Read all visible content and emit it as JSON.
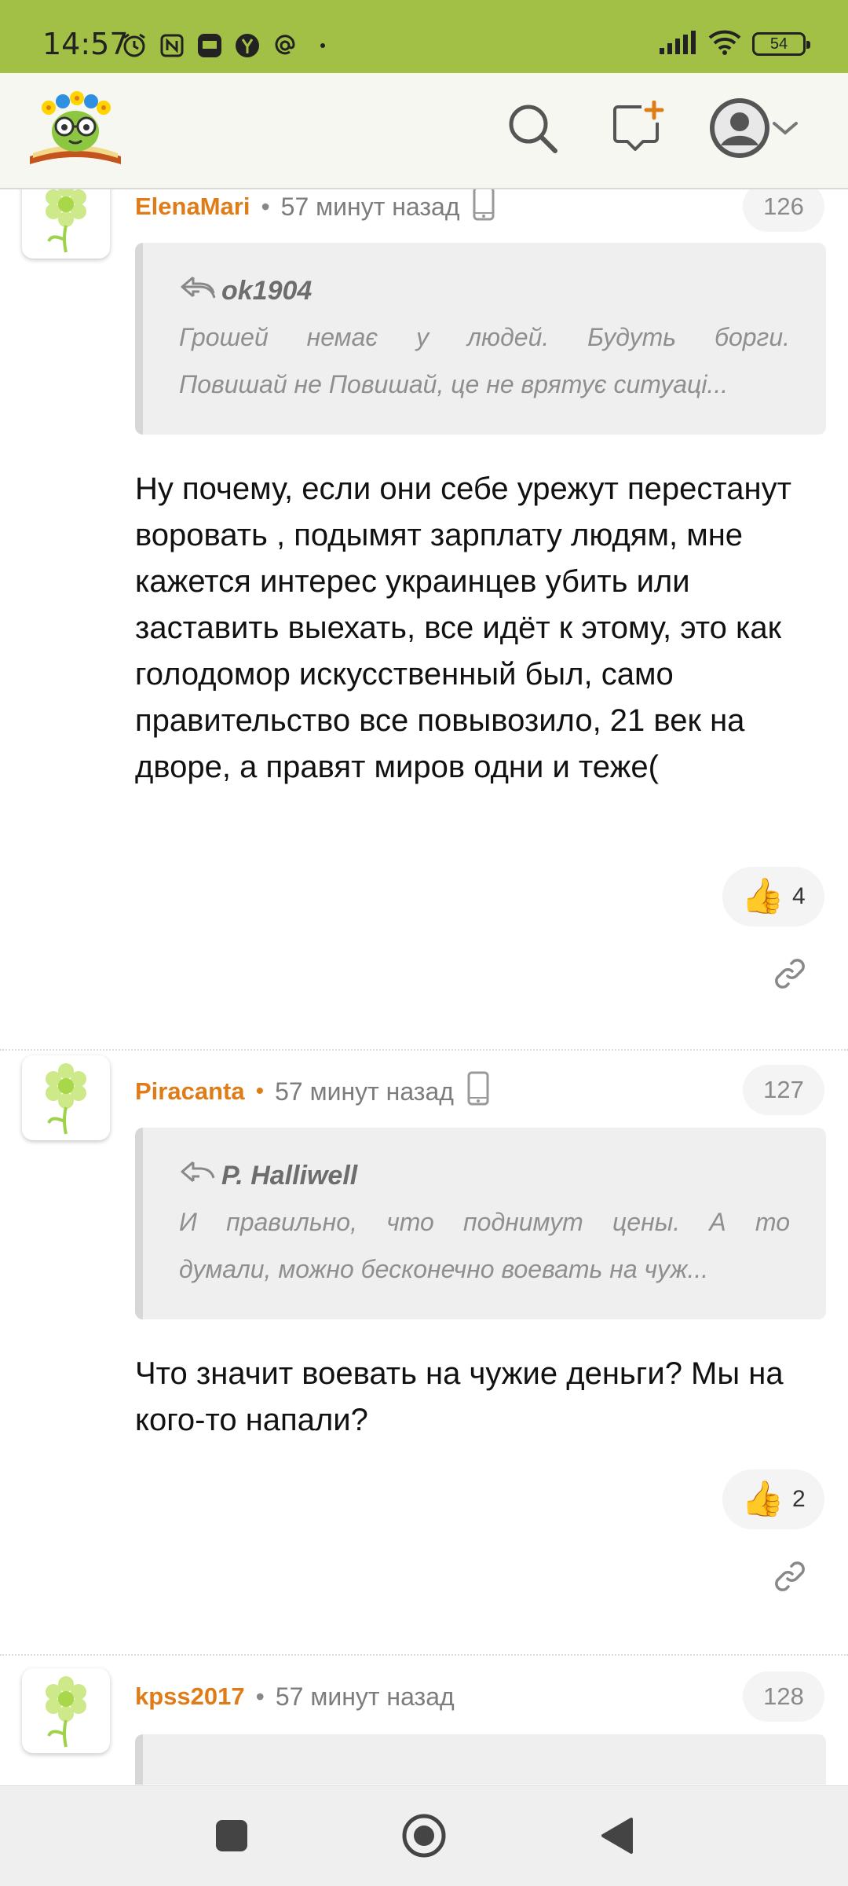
{
  "status_bar": {
    "time": "14:57",
    "left_icons": [
      "alarm-icon",
      "nfc-icon",
      "ad-blocker-icon",
      "yandex-icon",
      "at-icon",
      "dot-icon"
    ],
    "battery": "54"
  },
  "header": {
    "logo": "reader-bookworm-logo",
    "icons": [
      "search-icon",
      "new-message-icon",
      "user-avatar-icon",
      "chevron-down-icon"
    ]
  },
  "comments": [
    {
      "author": "ElenaMari",
      "time": "57 минут назад",
      "device_icon": "mobile-phone-icon",
      "number": "126",
      "quote": {
        "author": "ok1904",
        "line1": "Грошей немає у людей. Будуть борги.",
        "line2": "Повишай не Повишай, це не врятує ситуаці..."
      },
      "text": "Ну почему, если они себе урежут перестанут воровать , подымят зарплату людям, мне кажется интерес украинцев убить или заставить выехать, все идёт к этому, это как голодомор искусственный был, само правительство все повывозило, 21 век на дворе, а правят миров одни и теже(",
      "likes": "4"
    },
    {
      "author": "Piracanta",
      "time": "57 минут назад",
      "device_icon": "mobile-phone-icon",
      "number": "127",
      "quote": {
        "author": "P. Halliwell",
        "line1": "И правильно, что поднимут цены. А то",
        "line2": "думали, можно бесконечно воевать на чуж..."
      },
      "text": "Что значит воевать на чужие деньги? Мы на кого-то напали?",
      "likes": "2"
    },
    {
      "author": "kpss2017",
      "time": "57 минут назад",
      "number": "128"
    }
  ],
  "colors": {
    "status_bar": "#a3c046",
    "author": "#e07c18",
    "header_bg": "#f7f7f2"
  }
}
